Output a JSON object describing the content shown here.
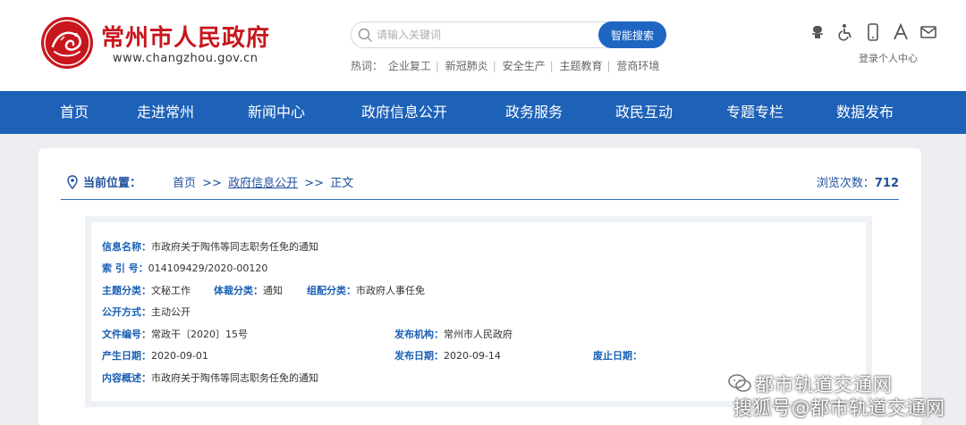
{
  "header": {
    "site_name": "常州市人民政府",
    "site_url": "www.changzhou.gov.cn",
    "search": {
      "placeholder": "请输入关键词",
      "button_label": "智能搜索"
    },
    "hot": {
      "label": "热词：",
      "items": [
        "企业复工",
        "新冠肺炎",
        "安全生产",
        "主题教育",
        "营商环境"
      ]
    },
    "tools": [
      "accessibility-elder-icon",
      "wheelchair-icon",
      "mobile-icon",
      "font-size-icon",
      "mail-icon"
    ],
    "login_label": "登录个人中心"
  },
  "nav": {
    "items": [
      "首页",
      "走进常州",
      "新闻中心",
      "政府信息公开",
      "政务服务",
      "政民互动",
      "专题专栏",
      "数据发布"
    ]
  },
  "location": {
    "label": "当前位置：",
    "crumbs": [
      "首页",
      "政府信息公开",
      "正文"
    ],
    "separator": ">>",
    "views_label": "浏览次数：",
    "views_count": "712"
  },
  "info": {
    "name_key": "信息名称：",
    "name_val": "市政府关于陶伟等同志职务任免的通知",
    "index_key": "索 引 号：",
    "index_val": "014109429/2020-00120",
    "topic_key": "主题分类：",
    "topic_val": "文秘工作",
    "genre_key": "体裁分类：",
    "genre_val": "通知",
    "org_class_key": "组配分类：",
    "org_class_val": "市政府人事任免",
    "open_key": "公开方式：",
    "open_val": "主动公开",
    "doc_no_key": "文件编号：",
    "doc_no_val": "常政干〔2020〕15号",
    "publisher_key": "发布机构：",
    "publisher_val": "常州市人民政府",
    "created_key": "产生日期：",
    "created_val": "2020-09-01",
    "published_key": "发布日期：",
    "published_val": "2020-09-14",
    "expiry_key": "废止日期：",
    "expiry_val": "",
    "summary_key": "内容概述：",
    "summary_val": "市政府关于陶伟等同志职务任免的通知"
  },
  "watermark": {
    "line1": "都市轨道交通网",
    "line2": "搜狐号@都市轨道交通网"
  },
  "colors": {
    "brand_red": "#c8161d",
    "nav_blue": "#1e62b8",
    "key_blue": "#1a5fb4"
  }
}
